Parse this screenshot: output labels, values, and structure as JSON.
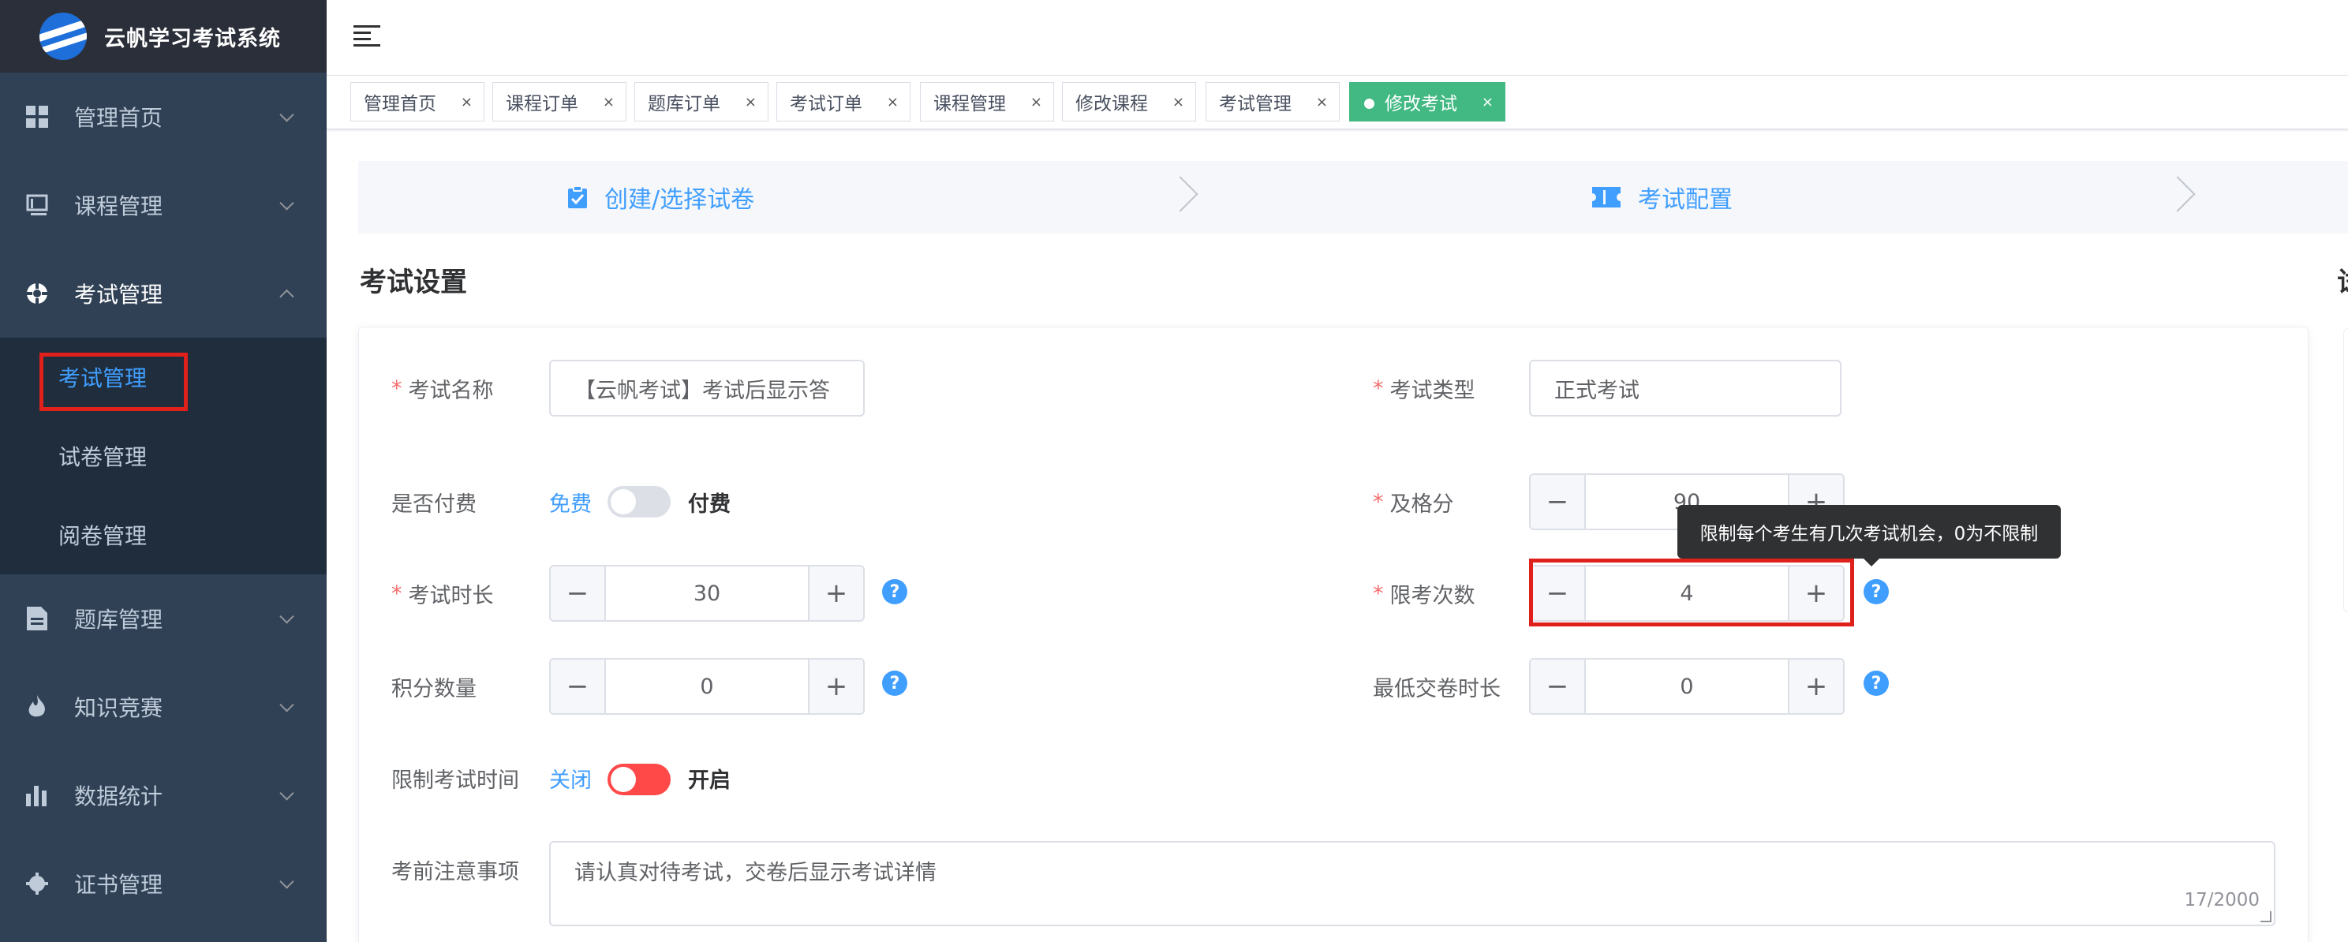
{
  "app": {
    "title": "云帆学习考试系统"
  },
  "sidebar": {
    "items": [
      {
        "label": "管理首页",
        "icon": "dashboard-icon"
      },
      {
        "label": "课程管理",
        "icon": "book-icon"
      },
      {
        "label": "考试管理",
        "icon": "exam-icon",
        "expanded": true
      },
      {
        "label": "题库管理",
        "icon": "document-icon"
      },
      {
        "label": "知识竞赛",
        "icon": "flame-icon"
      },
      {
        "label": "数据统计",
        "icon": "bar-chart-icon"
      },
      {
        "label": "证书管理",
        "icon": "certificate-icon"
      }
    ],
    "submenu": [
      "考试管理",
      "试卷管理",
      "阅卷管理"
    ],
    "active_sub": "考试管理"
  },
  "tags": [
    {
      "label": "管理首页"
    },
    {
      "label": "课程订单"
    },
    {
      "label": "题库订单"
    },
    {
      "label": "考试订单"
    },
    {
      "label": "课程管理"
    },
    {
      "label": "修改课程"
    },
    {
      "label": "考试管理"
    },
    {
      "label": "修改考试",
      "active": true
    }
  ],
  "steps": [
    {
      "label": "创建/选择试卷",
      "icon": "clipboard-check-icon"
    },
    {
      "label": "考试配置",
      "icon": "ticket-icon"
    }
  ],
  "section": {
    "title": "考试设置",
    "title_right_partial": "试"
  },
  "form": {
    "exam_name": {
      "label": "考试名称",
      "value": "【云帆考试】考试后显示答"
    },
    "exam_type": {
      "label": "考试类型",
      "value": "正式考试"
    },
    "paid": {
      "label": "是否付费",
      "off_text": "免费",
      "on_text": "付费",
      "on": false
    },
    "pass_score": {
      "label": "及格分",
      "value": "90"
    },
    "duration": {
      "label": "考试时长",
      "value": "30"
    },
    "attempt_limit": {
      "label": "限考次数",
      "value": "4"
    },
    "points": {
      "label": "积分数量",
      "value": "0"
    },
    "min_submit": {
      "label": "最低交卷时长",
      "value": "0"
    },
    "limit_time": {
      "label": "限制考试时间",
      "off_text": "关闭",
      "on_text": "开启",
      "on": false
    },
    "notice": {
      "label": "考前注意事项",
      "value": "请认真对待考试，交卷后显示考试详情",
      "counter": "17/2000"
    }
  },
  "tooltip": {
    "text": "限制每个考生有几次考试机会，0为不限制"
  },
  "colors": {
    "primary": "#409eff",
    "sidebar_bg": "#304156",
    "tag_active": "#42b983",
    "switch_off_red": "#ff4949",
    "highlight": "#e0201a",
    "required": "#f56c6c"
  },
  "glyphs": {
    "minus": "−",
    "plus": "+",
    "help": "?",
    "close": "×"
  }
}
